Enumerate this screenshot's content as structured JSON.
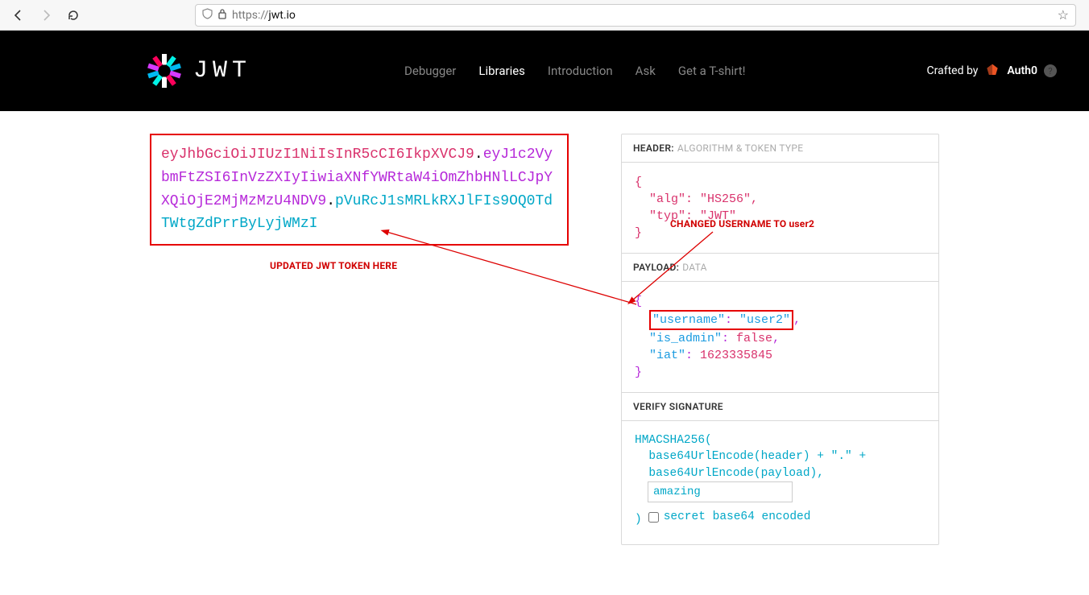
{
  "browser": {
    "url_proto": "https://",
    "url_domain": "jwt.io"
  },
  "header": {
    "brand": "JWT",
    "nav": {
      "debugger": "Debugger",
      "libraries": "Libraries",
      "introduction": "Introduction",
      "ask": "Ask",
      "tshirt": "Get a T-shirt!"
    },
    "crafted_label": "Crafted by",
    "auth0_label": "Auth0"
  },
  "encoded": {
    "header": "eyJhbGciOiJIUzI1NiIsInR5cCI6IkpXVCJ9",
    "payload": "eyJ1c2VybmFtZSI6InVzZXIyIiwiaXNfYWRtaW4iOmZhbHNlLCJpYXQiOjE2MjMzMzU4NDV9",
    "signature": "pVuRcJ1sMRLkRXJlFIs9OQ0TdTWtgZdPrrByLyjWMzI"
  },
  "decoded": {
    "header_title": "HEADER:",
    "header_sub": "ALGORITHM & TOKEN TYPE",
    "header_body": "{\n  \"alg\": \"HS256\",\n  \"typ\": \"JWT\"\n}",
    "payload_title": "PAYLOAD:",
    "payload_sub": "DATA",
    "payload": {
      "username_key": "\"username\"",
      "username_val": "\"user2\"",
      "is_admin_key": "\"is_admin\"",
      "is_admin_val": "false",
      "iat_key": "\"iat\"",
      "iat_val": "1623335845"
    },
    "verify_title": "VERIFY SIGNATURE",
    "verify": {
      "l1": "HMACSHA256(",
      "l2": "  base64UrlEncode(header) + \".\" +",
      "l3": "  base64UrlEncode(payload),",
      "secret": "amazing",
      "l4": ")",
      "checkbox_label": "secret base64 encoded"
    }
  },
  "annotations": {
    "updated": "UPDATED JWT TOKEN HERE",
    "changed": "CHANGED USERNAME TO user2"
  }
}
